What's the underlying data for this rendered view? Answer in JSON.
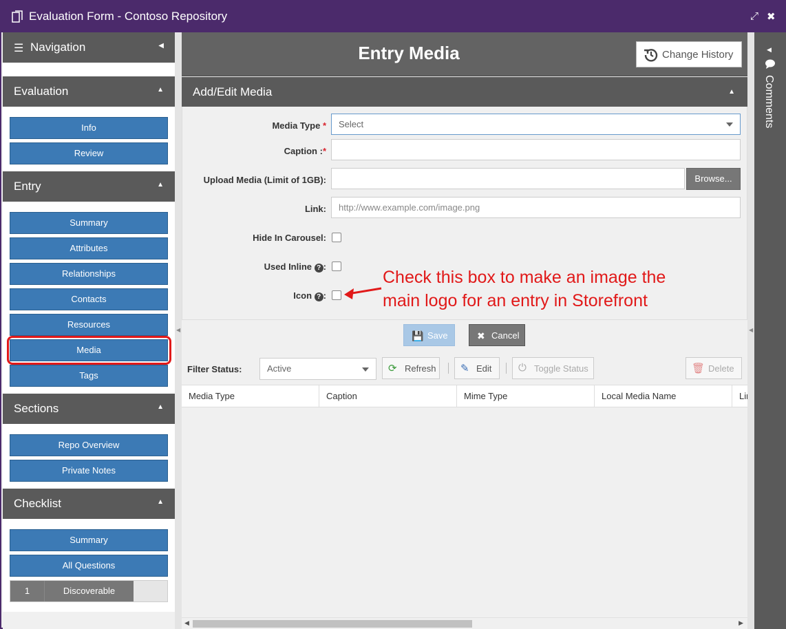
{
  "window": {
    "title": "Evaluation Form - Contoso Repository",
    "expand_glyph": "⤢",
    "close_glyph": "✖"
  },
  "sidebar": {
    "navigation": {
      "label": "Navigation",
      "caret": "◀",
      "menu_glyph": "☰"
    },
    "sections": [
      {
        "label": "Evaluation",
        "caret": "▲",
        "items": [
          "Info",
          "Review"
        ]
      },
      {
        "label": "Entry",
        "caret": "▲",
        "items": [
          "Summary",
          "Attributes",
          "Relationships",
          "Contacts",
          "Resources",
          "Media",
          "Tags"
        ]
      },
      {
        "label": "Sections",
        "caret": "▲",
        "items": [
          "Repo Overview",
          "Private Notes"
        ]
      },
      {
        "label": "Checklist",
        "caret": "▲",
        "items": [
          "Summary",
          "All Questions"
        ]
      }
    ],
    "selected_item": "Media",
    "checklist_row": {
      "number": "1",
      "label": "Discoverable"
    }
  },
  "page": {
    "title": "Entry Media",
    "change_history_label": "Change History"
  },
  "panel": {
    "title": "Add/Edit Media",
    "caret": "▲",
    "fields": {
      "media_type": {
        "label": "Media Type",
        "required": "*",
        "value": "Select"
      },
      "caption": {
        "label": "Caption :",
        "required": "*",
        "value": ""
      },
      "upload": {
        "label": "Upload Media (Limit of 1GB):",
        "value": "",
        "browse_label": "Browse..."
      },
      "link": {
        "label": "Link:",
        "placeholder": "http://www.example.com/image.png"
      },
      "hide_in_carousel": {
        "label": "Hide In Carousel:",
        "checked": false
      },
      "used_inline": {
        "label": "Used Inline",
        "suffix": ":",
        "help_glyph": "?",
        "checked": false
      },
      "icon": {
        "label": "Icon",
        "suffix": ":",
        "help_glyph": "?",
        "checked": false
      }
    },
    "annotation": {
      "line1": "Check this box to make an image the",
      "line2": "main logo for an entry in Storefront",
      "color": "#e11919"
    },
    "save_label": "Save",
    "cancel_label": "Cancel",
    "save_icon": "💾",
    "cancel_icon": "✖"
  },
  "toolbar": {
    "filter_label": "Filter Status:",
    "filter_value": "Active",
    "refresh_label": "Refresh",
    "refresh_icon": "⟳",
    "edit_label": "Edit",
    "edit_icon": "✎",
    "toggle_label": "Toggle Status",
    "toggle_icon": "⏻",
    "delete_label": "Delete",
    "delete_icon": "🗑"
  },
  "grid": {
    "columns": [
      "Media Type",
      "Caption",
      "Mime Type",
      "Local Media Name",
      "Link"
    ],
    "rows": []
  },
  "comments": {
    "label": "Comments",
    "caret": "◀"
  },
  "colors": {
    "titlebar": "#4b2a6b",
    "header_gray": "#5a5a5a",
    "nav_button_blue": "#3c7ab5",
    "highlight_red": "#e11919"
  }
}
